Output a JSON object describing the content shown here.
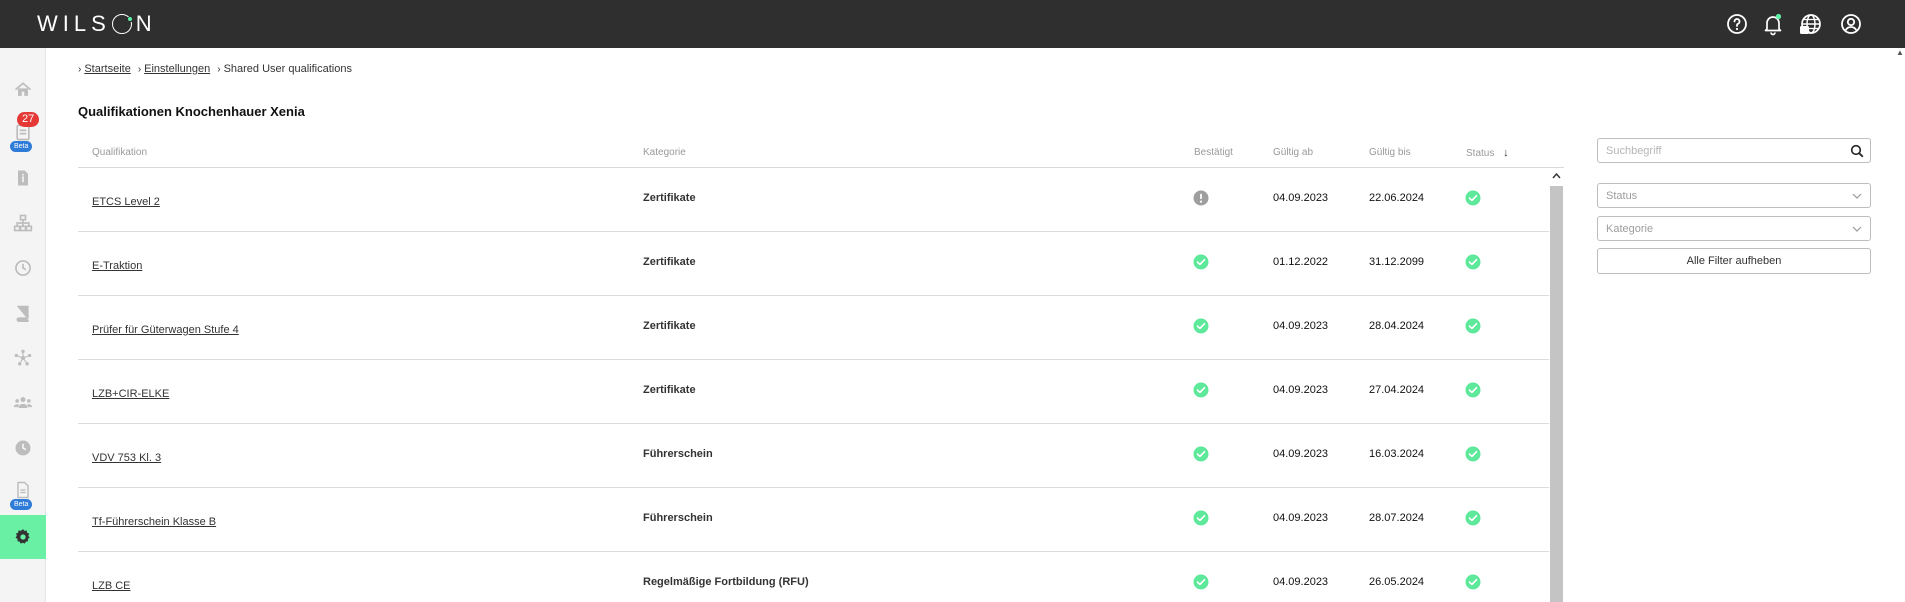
{
  "app": {
    "logo_prefix": "WILS",
    "logo_suffix": "N"
  },
  "sidebar": {
    "items": [
      {
        "name": "home",
        "icon": "home-icon"
      },
      {
        "name": "tasks",
        "icon": "clipboard-icon",
        "count": "27",
        "badge": "Beta"
      },
      {
        "name": "documents",
        "icon": "document-icon"
      },
      {
        "name": "organisation",
        "icon": "org-chart-icon"
      },
      {
        "name": "time",
        "icon": "clock-icon"
      },
      {
        "name": "book",
        "icon": "book-icon"
      },
      {
        "name": "network",
        "icon": "network-icon"
      },
      {
        "name": "users",
        "icon": "users-icon"
      },
      {
        "name": "history",
        "icon": "clock-filled-icon"
      },
      {
        "name": "reports",
        "icon": "report-icon",
        "badge": "Beta"
      },
      {
        "name": "settings",
        "icon": "gear-icon"
      }
    ]
  },
  "breadcrumb": {
    "home": "Startseite",
    "settings": "Einstellungen",
    "current": "Shared User qualifications"
  },
  "page": {
    "title": "Qualifikationen Knochenhauer Xenia"
  },
  "table": {
    "headers": {
      "qualifikation": "Qualifikation",
      "kategorie": "Kategorie",
      "bestaetigt": "Bestätigt",
      "gueltig_ab": "Gültig ab",
      "gueltig_bis": "Gültig bis",
      "status": "Status"
    },
    "rows": [
      {
        "qualifikation": "ETCS Level 2",
        "kategorie": "Zertifikate",
        "bestaetigt": "pending",
        "gueltig_ab": "04.09.2023",
        "gueltig_bis": "22.06.2024",
        "status": "ok"
      },
      {
        "qualifikation": "E-Traktion",
        "kategorie": "Zertifikate",
        "bestaetigt": "ok",
        "gueltig_ab": "01.12.2022",
        "gueltig_bis": "31.12.2099",
        "status": "ok"
      },
      {
        "qualifikation": "Prüfer für Güterwagen Stufe 4",
        "kategorie": "Zertifikate",
        "bestaetigt": "ok",
        "gueltig_ab": "04.09.2023",
        "gueltig_bis": "28.04.2024",
        "status": "ok"
      },
      {
        "qualifikation": "LZB+CIR-ELKE",
        "kategorie": "Zertifikate",
        "bestaetigt": "ok",
        "gueltig_ab": "04.09.2023",
        "gueltig_bis": "27.04.2024",
        "status": "ok"
      },
      {
        "qualifikation": "VDV 753 Kl. 3",
        "kategorie": "Führerschein",
        "bestaetigt": "ok",
        "gueltig_ab": "04.09.2023",
        "gueltig_bis": "16.03.2024",
        "status": "ok"
      },
      {
        "qualifikation": "Tf-Führerschein Klasse B",
        "kategorie": "Führerschein",
        "bestaetigt": "ok",
        "gueltig_ab": "04.09.2023",
        "gueltig_bis": "28.07.2024",
        "status": "ok"
      },
      {
        "qualifikation": "LZB CE",
        "kategorie": "Regelmäßige Fortbildung (RFU)",
        "bestaetigt": "ok",
        "gueltig_ab": "04.09.2023",
        "gueltig_bis": "26.05.2024",
        "status": "ok"
      }
    ]
  },
  "filters": {
    "search_placeholder": "Suchbegriff",
    "status_placeholder": "Status",
    "kategorie_placeholder": "Kategorie",
    "clear_label": "Alle Filter aufheben"
  },
  "colors": {
    "accent": "#69f0a4",
    "topbar": "#2f2f2f",
    "ok": "#5ee89a",
    "pending": "#9e9e9e",
    "badge": "#e53935",
    "beta": "#2f7bd8"
  }
}
